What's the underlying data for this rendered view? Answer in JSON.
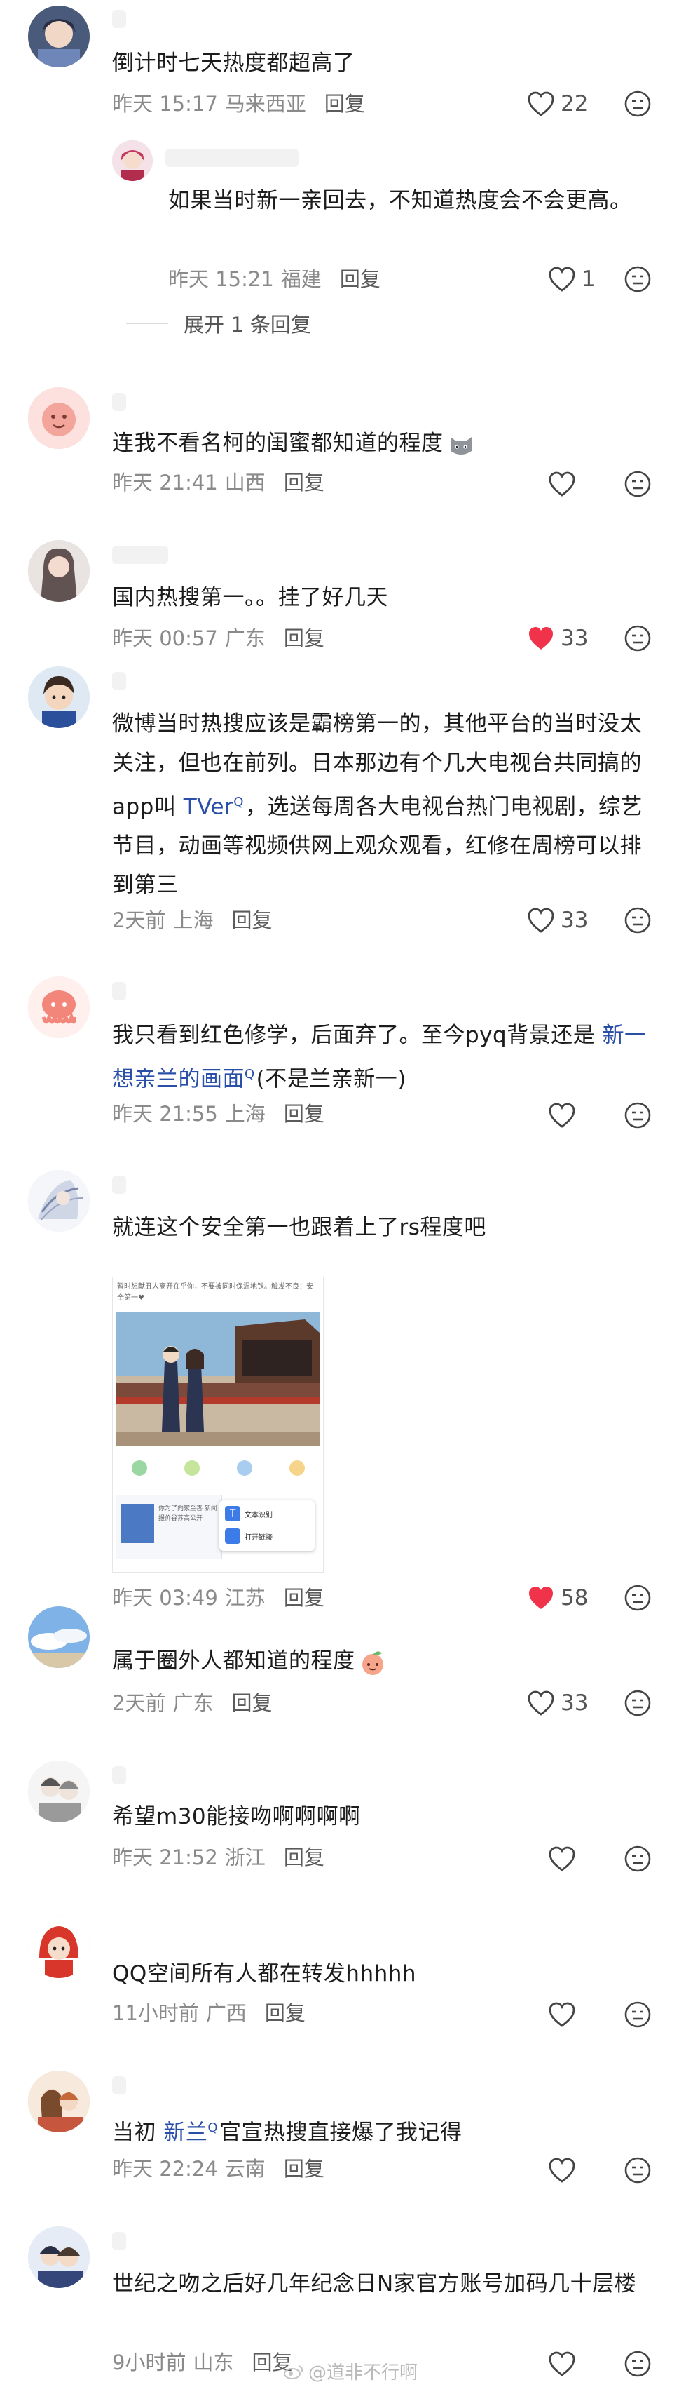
{
  "comments": [
    {
      "text": "倒计时七天热度都超高了",
      "time": "昨天 15:17",
      "region": "马来西亚",
      "reply": "回复",
      "likes": "22",
      "liked": false,
      "avatar_icon": "anime-boy-avatar-icon",
      "replies": [
        {
          "text": "如果当时新一亲回去，不知道热度会不会更高。",
          "time": "昨天 15:21",
          "region": "福建",
          "reply": "回复",
          "likes": "1",
          "liked": false,
          "avatar_icon": "anime-girl-avatar-icon"
        }
      ],
      "expand_label": "展开 1 条回复"
    },
    {
      "text": "连我不看名柯的闺蜜都知道的程度",
      "emoji": "cat-face-emoji",
      "time": "昨天 21:41",
      "region": "山西",
      "reply": "回复",
      "likes": "",
      "liked": false,
      "avatar_icon": "pink-bird-avatar-icon"
    },
    {
      "text": "国内热搜第一。。挂了好几天",
      "time": "昨天 00:57",
      "region": "广东",
      "reply": "回复",
      "likes": "33",
      "liked": true,
      "avatar_icon": "girl-portrait-avatar-icon"
    },
    {
      "text_parts": [
        {
          "t": "微博当时热搜应该是霸榜第一的，其他平台的当时没太关注，但也在前列。日本那边有个几大电视台共同搞的app叫 "
        },
        {
          "t": "TVer",
          "link": true
        },
        {
          "t": "，选送每周各大电视台热门电视剧，综艺节目，动画等视频供网上观众观看，红修在周榜可以排到第三"
        }
      ],
      "time": "2天前",
      "region": "上海",
      "reply": "回复",
      "likes": "33",
      "liked": false,
      "avatar_icon": "cartoon-boy-avatar-icon"
    },
    {
      "text_parts": [
        {
          "t": "我只看到红色修学，后面弃了。至今pyq背景还是 "
        },
        {
          "t": "新一想亲兰的画面",
          "link": true
        },
        {
          "t": "(不是兰亲新一)"
        }
      ],
      "time": "昨天 21:55",
      "region": "上海",
      "reply": "回复",
      "likes": "",
      "liked": false,
      "avatar_icon": "pink-octopus-avatar-icon"
    },
    {
      "text": "就连这个安全第一也跟着上了rs程度吧",
      "time": "昨天 03:49",
      "region": "江苏",
      "reply": "回复",
      "likes": "58",
      "liked": true,
      "avatar_icon": "white-hair-avatar-icon",
      "image": {
        "caption_top": "暂时想献丑人离开在乎你，不要被同时保温地铁。触发不良：安全第一♥",
        "popup_lines": [
          "文本识别",
          "打开链接"
        ],
        "preview_text": "你为了向家至善  新闻报价谷苏高公开"
      }
    },
    {
      "text": "属于圈外人都知道的程度",
      "emoji": "peach-emoji",
      "time": "2天前",
      "region": "广东",
      "reply": "回复",
      "likes": "33",
      "liked": false,
      "avatar_icon": "sky-avatar-icon"
    },
    {
      "text": "希望m30能接吻啊啊啊啊",
      "time": "昨天 21:52",
      "region": "浙江",
      "reply": "回复",
      "likes": "",
      "liked": false,
      "avatar_icon": "sketch-couple-avatar-icon"
    },
    {
      "text": "QQ空间所有人都在转发hhhhh",
      "time": "11小时前",
      "region": "广西",
      "reply": "回复",
      "likes": "",
      "liked": false,
      "avatar_icon": "red-hood-avatar-icon"
    },
    {
      "text_parts": [
        {
          "t": "当初 "
        },
        {
          "t": "新兰",
          "link": true
        },
        {
          "t": "官宣热搜直接爆了我记得"
        }
      ],
      "time": "昨天 22:24",
      "region": "云南",
      "reply": "回复",
      "likes": "",
      "liked": false,
      "avatar_icon": "anime-couple-avatar-icon"
    },
    {
      "text": "世纪之吻之后好几年纪念日N家官方账号加码几十层楼",
      "time": "9小时前",
      "region": "山东",
      "reply": "回复",
      "likes": "",
      "liked": false,
      "avatar_icon": "anime-pair-avatar-icon"
    }
  ],
  "watermark": "@道非不行啊",
  "colors": {
    "liked_heart": "#f0334a",
    "link": "#2a4fa8",
    "meta": "#8a8a8a"
  }
}
